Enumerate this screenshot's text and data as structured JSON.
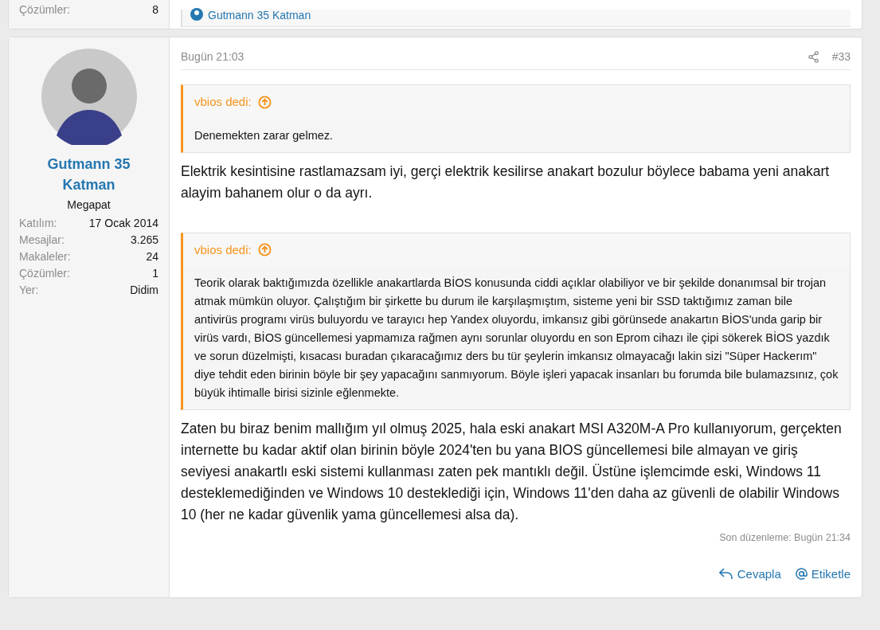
{
  "previous_post": {
    "stat": {
      "label": "Çözümler:",
      "value": "8"
    },
    "signature_link": "Gutmann 35 Katman"
  },
  "post": {
    "author": {
      "name": "Gutmann 35 Katman",
      "title": "Megapat",
      "stats": [
        {
          "label": "Katılım:",
          "value": "17 Ocak 2014"
        },
        {
          "label": "Mesajlar:",
          "value": "3.265"
        },
        {
          "label": "Makaleler:",
          "value": "24"
        },
        {
          "label": "Çözümler:",
          "value": "1"
        },
        {
          "label": "Yer:",
          "value": "Didim"
        }
      ]
    },
    "date": "Bugün 21:03",
    "number": "#33",
    "blocks": [
      {
        "kind": "quote",
        "author": "vbios dedi:",
        "text": "Denemekten zarar gelmez."
      },
      {
        "kind": "text",
        "text": "Elektrik kesintisine rastlamazsam iyi, gerçi elektrik kesilirse anakart bozulur böylece babama yeni anakart alayim bahanem olur o da ayrı."
      },
      {
        "kind": "quote",
        "author": "vbios dedi:",
        "text": "Teorik olarak baktığımızda özellikle anakartlarda BİOS konusunda ciddi açıklar olabiliyor ve bir şekilde donanımsal bir trojan atmak mümkün oluyor. Çalıştığım bir şirkette bu durum ile karşılaşmıştım, sisteme yeni bir SSD taktığımız zaman bile antivirüs programı virüs buluyordu ve tarayıcı hep Yandex oluyordu, imkansız gibi görünsede anakartın BİOS'unda garip bir virüs vardı, BİOS güncellemesi yapmamıza rağmen aynı sorunlar oluyordu en son Eprom cihazı ile çipi sökerek BİOS yazdık ve sorun düzelmişti, kısacası buradan çıkaracağımız ders bu tür şeylerin imkansız olmayacağı lakin sizi \"Süper Hackerım\" diye tehdit eden birinin böyle bir şey yapacağını sanmıyorum. Böyle işleri yapacak insanları bu forumda bile bulamazsınız, çok büyük ihtimalle birisi sizinle eğlenmekte."
      },
      {
        "kind": "text",
        "text": "Zaten bu biraz benim mallığım yıl olmuş 2025, hala eski anakart MSI A320M-A Pro kullanıyorum, gerçekten internette bu kadar aktif olan birinin böyle 2024'ten bu yana BIOS güncellemesi bile almayan ve giriş seviyesi anakartlı eski sistemi kullanması zaten pek mantıklı değil. Üstüne işlemcimde eski, Windows 11 desteklemediğinden ve Windows 10 desteklediği için, Windows 11'den daha az güvenli de olabilir Windows 10 (her ne kadar güvenlik yama güncellemesi alsa da)."
      }
    ],
    "last_edit": "Son düzenleme: Bugün 21:34",
    "actions": [
      {
        "kind": "reply",
        "label": "Cevapla"
      },
      {
        "kind": "mention",
        "label": "Etiketle"
      }
    ]
  }
}
